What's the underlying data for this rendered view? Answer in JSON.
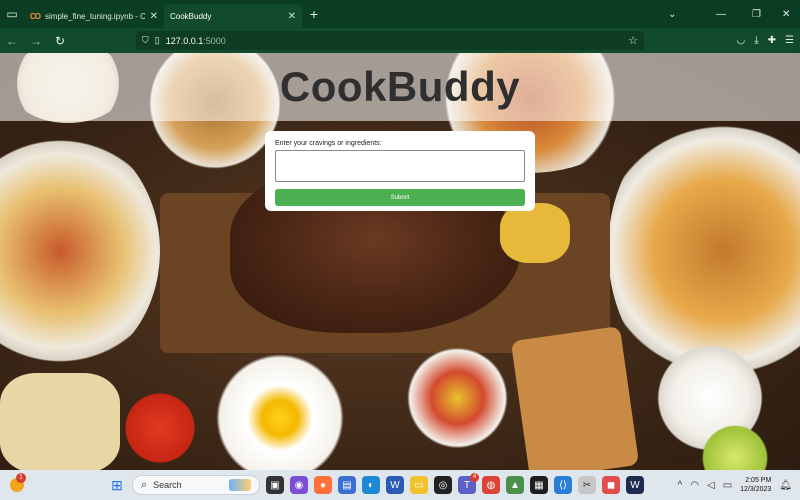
{
  "browser": {
    "tabs": [
      {
        "title": "simple_fine_tuning.ipynb - Colab",
        "icon": "colab-icon",
        "active": false
      },
      {
        "title": "CookBuddy",
        "active": true
      }
    ],
    "url": {
      "host": "127.0.0.1",
      "port": ":5000"
    }
  },
  "hero": {
    "title": "CookBuddy"
  },
  "form": {
    "label": "Enter your cravings or ingredients:",
    "input_value": "",
    "submit_label": "Submit"
  },
  "taskbar": {
    "search_label": "Search",
    "weather_badge": "1",
    "teams_badge": "4",
    "time": "2:05 PM",
    "date": "12/3/2023"
  },
  "colors": {
    "chrome_dark": "#0b3d24",
    "chrome": "#124a2e",
    "submit_green": "#4caf50",
    "title_text": "#2f2f2f"
  }
}
